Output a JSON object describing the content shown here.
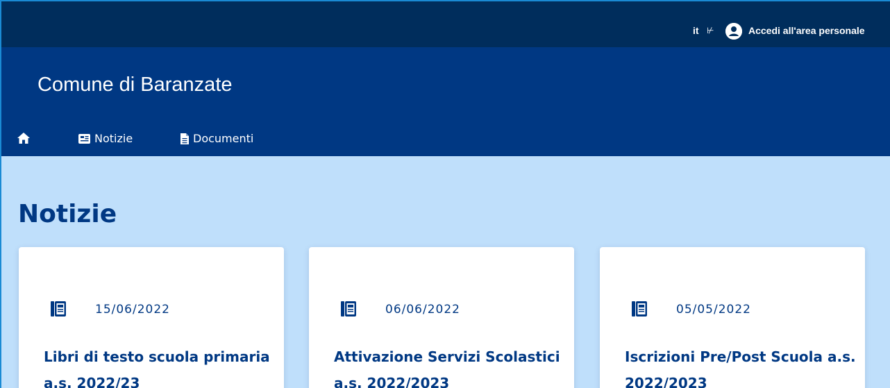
{
  "topbar": {
    "language": "it",
    "language_chevron": "⊬",
    "login_label": "Accedi all'area personale"
  },
  "header": {
    "site_title": "Comune di Baranzate"
  },
  "nav": {
    "home_icon": "home-icon",
    "items": [
      {
        "label": "Notizie",
        "icon": "newspaper-icon"
      },
      {
        "label": "Documenti",
        "icon": "document-icon"
      }
    ]
  },
  "main": {
    "title": "Notizie",
    "cards": [
      {
        "date": "15/06/2022",
        "title": "Libri di testo scuola primaria a.s. 2022/23"
      },
      {
        "date": "06/06/2022",
        "title": "Attivazione Servizi Scolastici a.s. 2022/2023"
      },
      {
        "date": "05/05/2022",
        "title": "Iscrizioni Pre/Post Scuola a.s. 2022/2023"
      }
    ]
  },
  "colors": {
    "topbar_bg": "#002d5c",
    "header_bg": "#003883",
    "main_bg": "#bfdffb",
    "accent_text": "#003883"
  }
}
